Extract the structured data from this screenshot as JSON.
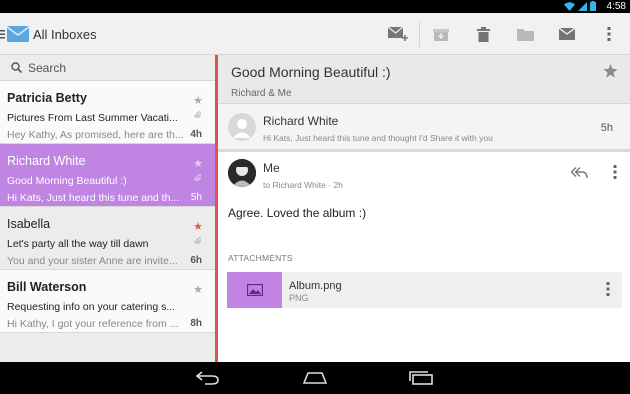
{
  "status_bar": {
    "time": "4:58"
  },
  "action_bar": {
    "title": "All Inboxes",
    "actions": [
      "compose-icon",
      "archive-icon",
      "delete-icon",
      "move-to-folder-icon",
      "mark-unread-icon",
      "overflow-menu-icon"
    ]
  },
  "search": {
    "placeholder": "Search"
  },
  "threads": [
    {
      "sender": "Patricia Betty",
      "subject": "Pictures From Last Summer Vacati...",
      "snippet": "Hey Kathy, As promised, here are th...",
      "time": "4h",
      "starred": false,
      "has_attachment": true,
      "selected": false
    },
    {
      "sender": "Richard White",
      "subject": "Good Morning Beautiful :)",
      "snippet": "Hi Kats, Just heard this tune and th...",
      "time": "5h",
      "starred": false,
      "has_attachment": true,
      "selected": true
    },
    {
      "sender": "Isabella",
      "subject": "Let's party all the way till dawn",
      "snippet": "You and your sister Anne are invite...",
      "time": "6h",
      "starred": true,
      "has_attachment": true,
      "selected": false
    },
    {
      "sender": "Bill Waterson",
      "subject": "Requesting info on your catering s...",
      "snippet": "Hi Kathy, I got your reference from ...",
      "time": "8h",
      "starred": false,
      "has_attachment": false,
      "selected": false
    }
  ],
  "conversation": {
    "subject": "Good Morning Beautiful :)",
    "participants": "Richard & Me",
    "collapsed_message": {
      "from": "Richard White",
      "snippet": "Hi Kats, Just heard this tune and thought I'd Share it with you",
      "time": "5h"
    },
    "expanded_message": {
      "from": "Me",
      "to_line": "to Richard White · 2h",
      "body": "Agree. Loved the album :)",
      "attachments_heading": "ATTACHMENTS",
      "attachment": {
        "name": "Album.png",
        "type": "PNG"
      }
    }
  },
  "colors": {
    "accent": "#c084e3",
    "divider": "#d9534f",
    "star_active": "#e05c52"
  }
}
